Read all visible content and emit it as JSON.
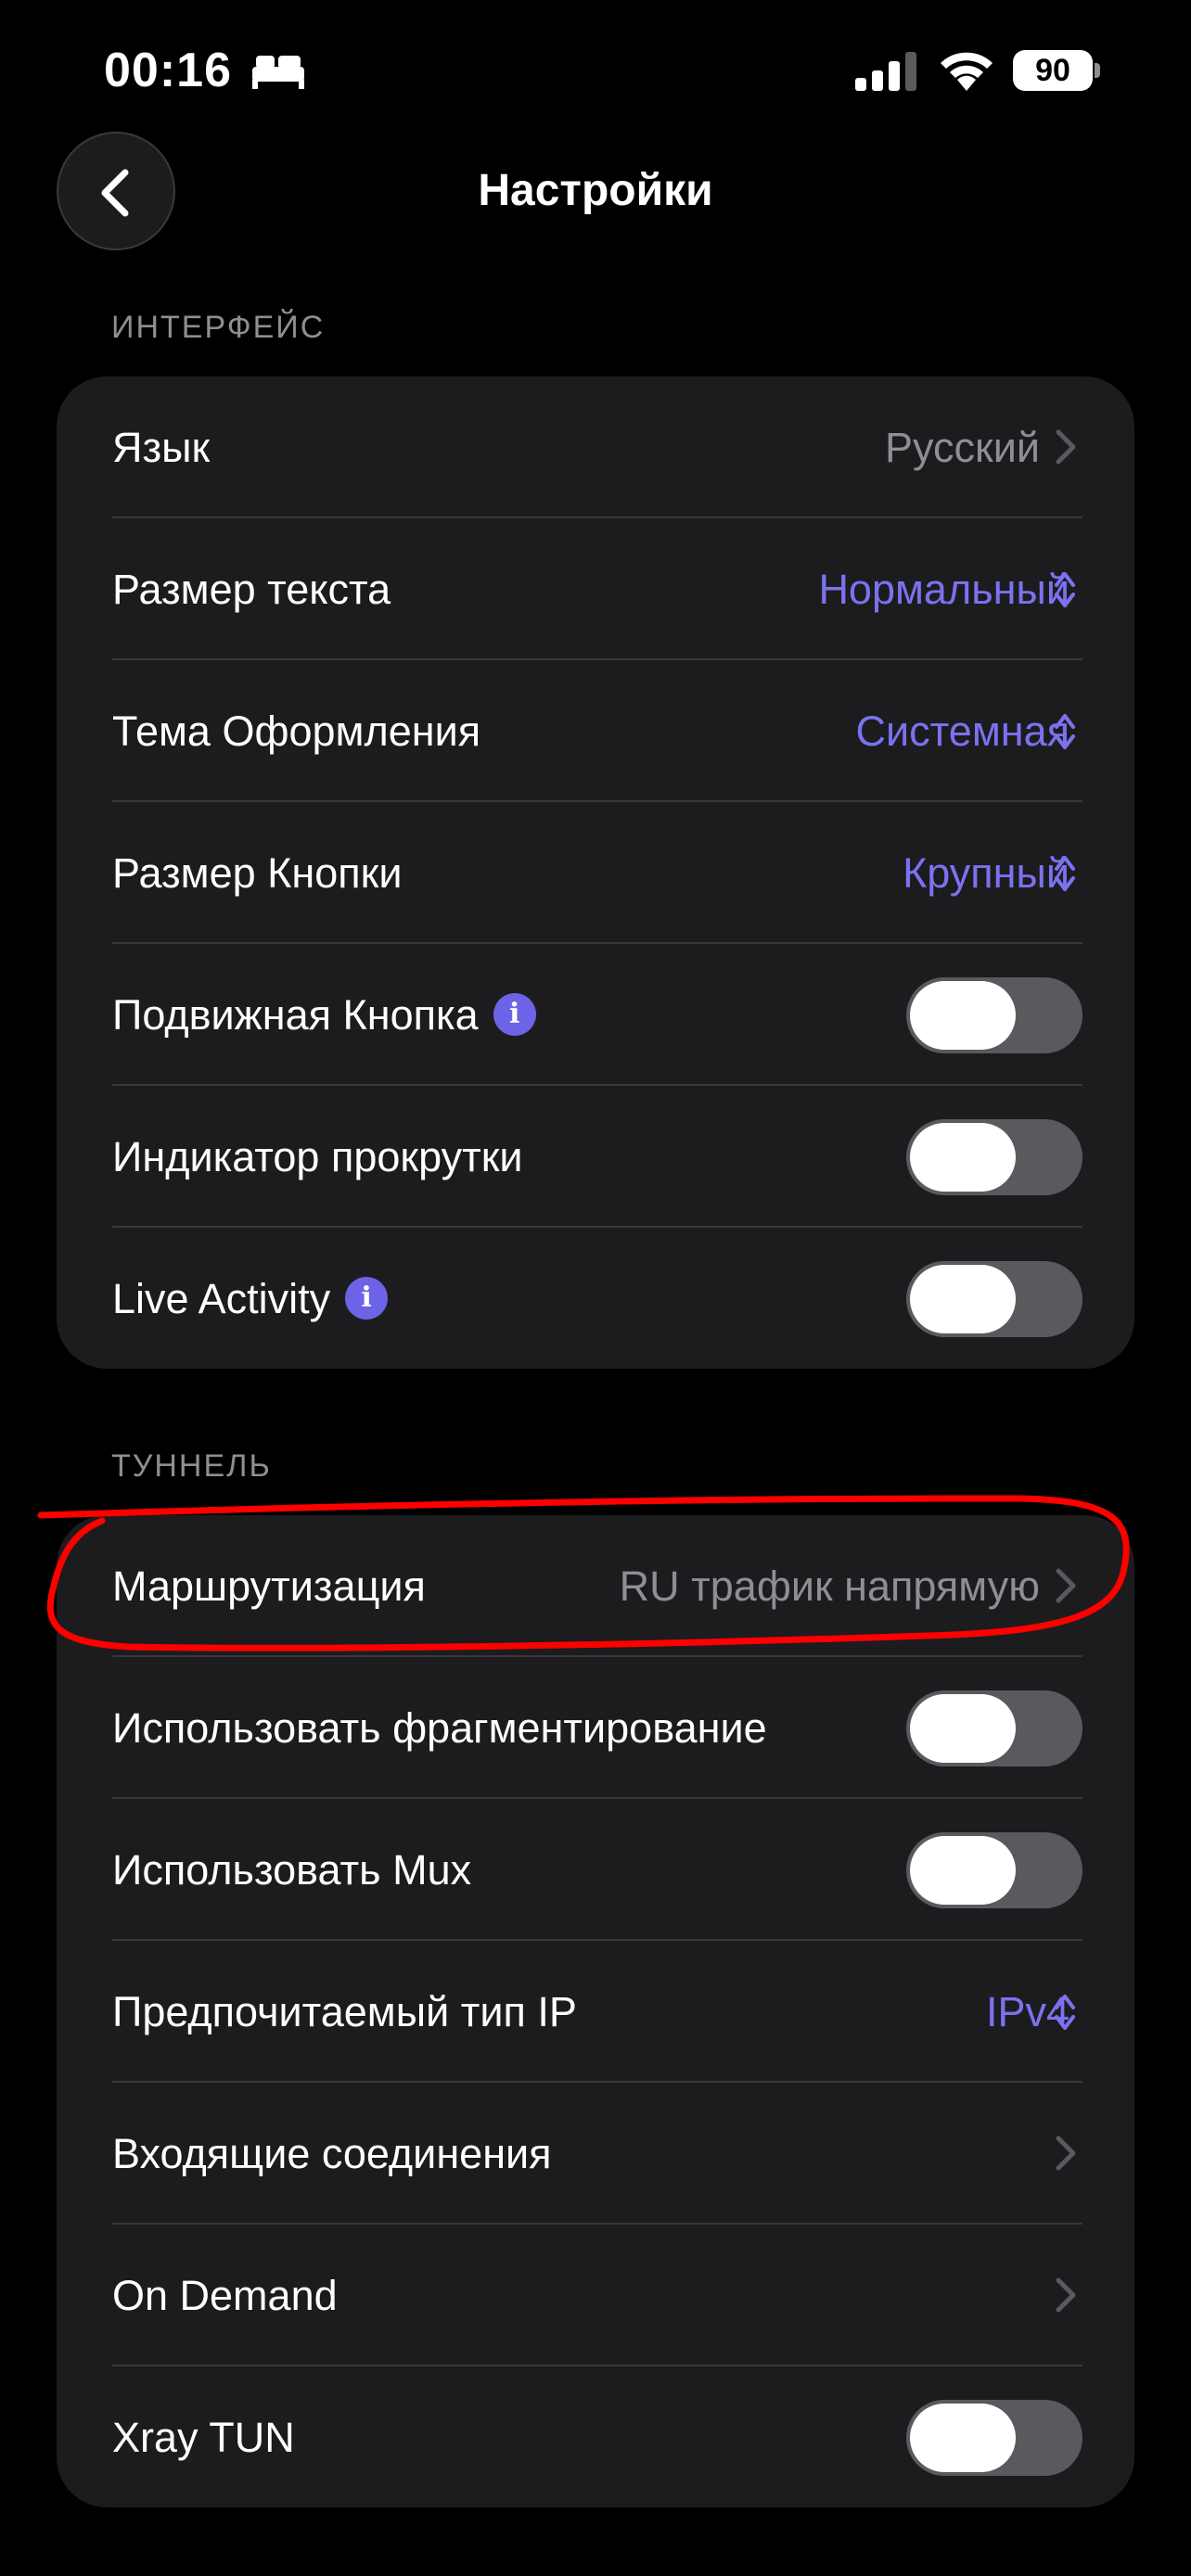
{
  "status_bar": {
    "time": "00:16",
    "battery": "90"
  },
  "nav": {
    "title": "Настройки"
  },
  "sections": {
    "interface": {
      "header": "ИНТЕРФЕЙС",
      "rows": [
        {
          "label": "Язык",
          "value": "Русский"
        },
        {
          "label": "Размер текста",
          "value": "Нормальный"
        },
        {
          "label": "Тема Оформления",
          "value": "Системная"
        },
        {
          "label": "Размер Кнопки",
          "value": "Крупный"
        },
        {
          "label": "Подвижная Кнопка",
          "toggle": false
        },
        {
          "label": "Индикатор прокрутки",
          "toggle": false
        },
        {
          "label": "Live Activity",
          "toggle": false
        }
      ]
    },
    "tunnel": {
      "header": "ТУННЕЛЬ",
      "rows": [
        {
          "label": "Маршрутизация",
          "value": "RU трафик напрямую"
        },
        {
          "label": "Использовать фрагментирование",
          "toggle": false
        },
        {
          "label": "Использовать Mux",
          "toggle": false
        },
        {
          "label": "Предпочитаемый тип IP",
          "value": "IPv4"
        },
        {
          "label": "Входящие соединения"
        },
        {
          "label": "On Demand"
        },
        {
          "label": "Xray TUN",
          "toggle": false
        }
      ]
    }
  },
  "info_glyph": "i",
  "colors": {
    "accent": "#7b72f0",
    "annotation": "#ff0000",
    "card": "#1c1c1e"
  }
}
